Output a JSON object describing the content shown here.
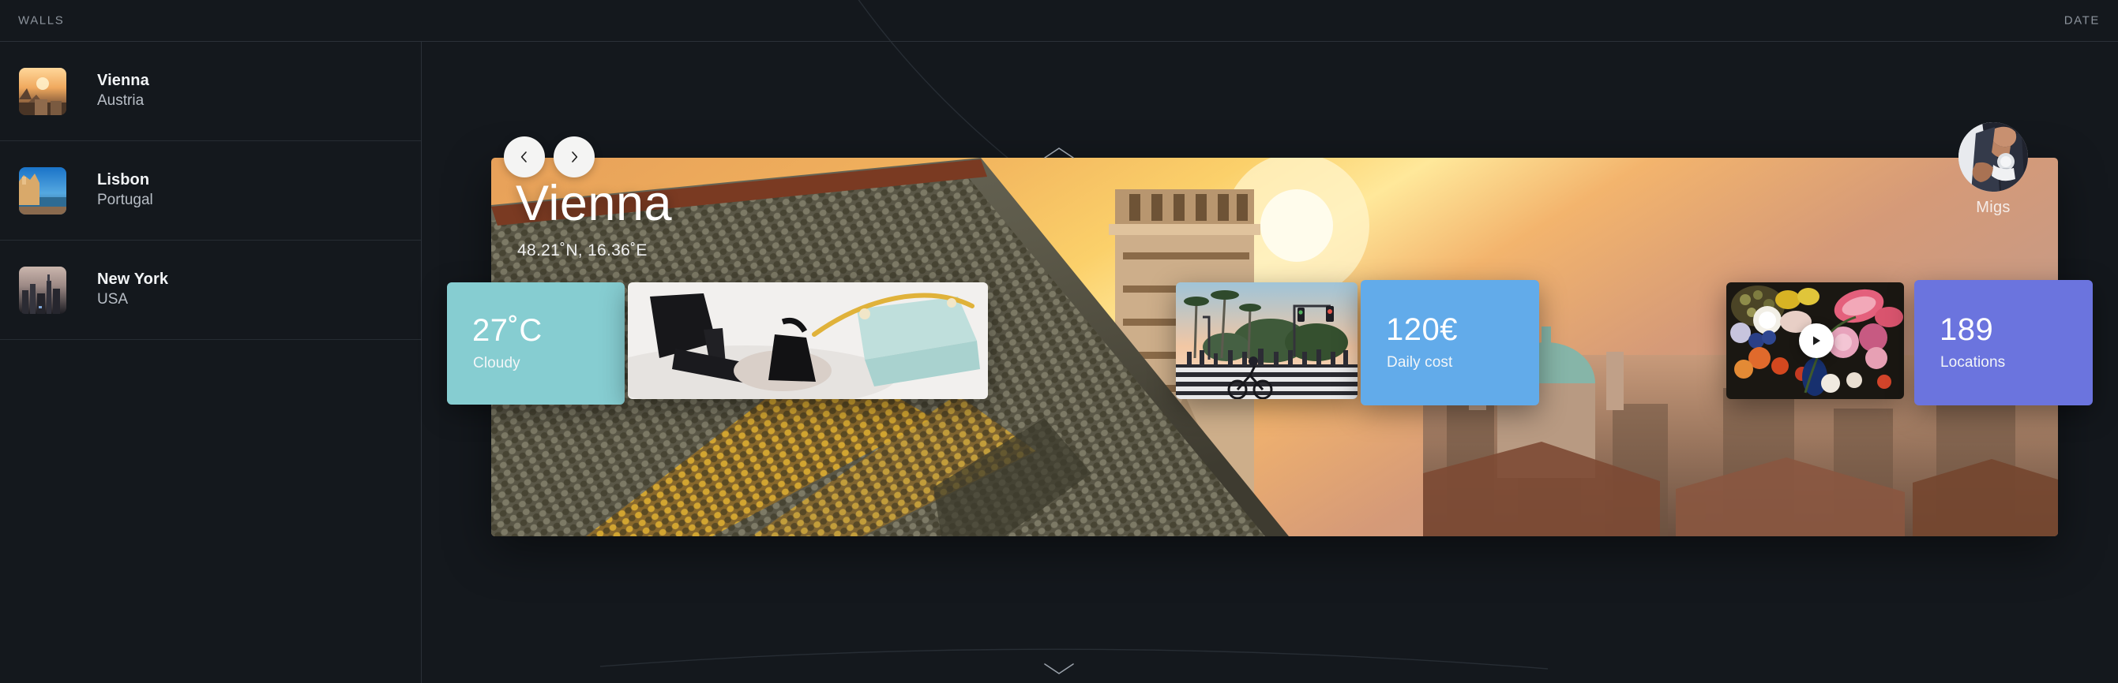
{
  "topbar": {
    "left_label": "WALLS",
    "right_label": "DATE"
  },
  "sidebar": {
    "items": [
      {
        "city": "Vienna",
        "country": "Austria",
        "thumb": "vienna-sunset-thumb"
      },
      {
        "city": "Lisbon",
        "country": "Portugal",
        "thumb": "lisbon-coast-thumb"
      },
      {
        "city": "New York",
        "country": "USA",
        "thumb": "newyork-skyline-thumb"
      }
    ]
  },
  "hero": {
    "title": "Vienna",
    "coordinates": "48.21˚N, 16.36˚E",
    "image": "vienna-cathedral-sunset",
    "prev_icon": "chevron-left-icon",
    "next_icon": "chevron-right-icon",
    "chevron_up_icon": "chevron-up-icon",
    "chevron_down_icon": "chevron-down-icon"
  },
  "user": {
    "name": "Migs",
    "avatar": "user-avatar-photo"
  },
  "cards": {
    "weather": {
      "value": "27˚C",
      "label": "Cloudy",
      "color": "#86cdd1"
    },
    "fashion": {
      "image": "fashion-shoes-bag-photo"
    },
    "street": {
      "image": "crosswalk-crowd-photo"
    },
    "cost": {
      "value": "120€",
      "label": "Daily cost",
      "color": "#62abea"
    },
    "flowers": {
      "image": "floral-still-life-photo",
      "play_icon": "play-icon"
    },
    "locations": {
      "value": "189",
      "label": "Locations",
      "color": "#6b74de"
    }
  },
  "colors": {
    "background": "#14181d",
    "divider": "#2b3138",
    "text_primary": "#f2f4f6",
    "text_secondary": "#b8bec6",
    "teal": "#86cdd1",
    "blue": "#62abea",
    "purple": "#6b74de"
  }
}
